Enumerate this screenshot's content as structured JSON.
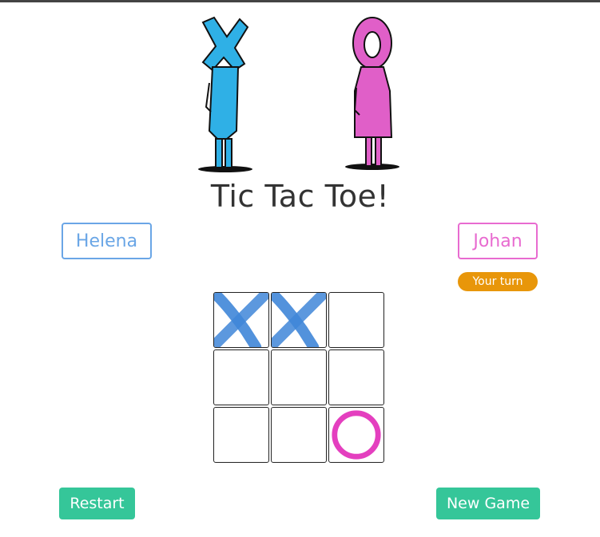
{
  "title": "Tic Tac Toe!",
  "players": {
    "x": {
      "name": "Helena",
      "color": "#6aa6e6"
    },
    "o": {
      "name": "Johan",
      "color": "#e86bd0"
    }
  },
  "turn_badge": {
    "label": "Your turn",
    "color": "#e8960a"
  },
  "board": {
    "cells": [
      "X",
      "X",
      "",
      "",
      "",
      "",
      "",
      "",
      "O"
    ],
    "x_color": "#3f86d8",
    "o_color": "#e43fbf"
  },
  "buttons": {
    "restart_label": "Restart",
    "new_game_label": "New Game",
    "color": "#35c699"
  },
  "icons": {
    "hero": "x-and-o-characters-illustration",
    "x_mark": "x-mark-icon",
    "o_mark": "o-mark-icon"
  }
}
